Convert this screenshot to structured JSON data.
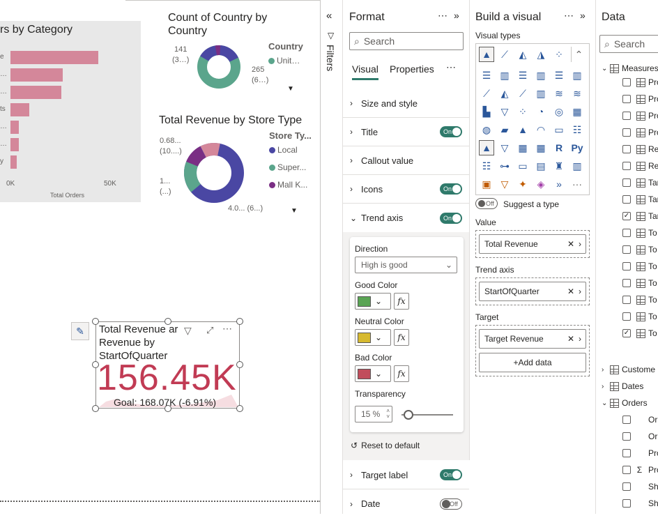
{
  "canvas": {
    "bar_chart": {
      "title": "rs by Category",
      "xlabel": "Total Orders",
      "ticks": [
        "0K",
        "50K"
      ],
      "row_labels": [
        "e",
        "…",
        "…",
        "ts",
        "…",
        "…",
        "y"
      ]
    },
    "donut1": {
      "title_line1": "Count of Country by",
      "title_line2": "Country",
      "legend_title": "Country",
      "legend": [
        {
          "label": "Unit…",
          "color": "#5ba58c"
        }
      ],
      "labels": [
        {
          "l1": "141",
          "l2": "(3…)"
        },
        {
          "l1": "265",
          "l2": "(6…)"
        }
      ]
    },
    "donut2": {
      "title": "Total Revenue by Store Type",
      "legend_title": "Store Ty...",
      "legend": [
        {
          "label": "Local",
          "color": "#4a47a3"
        },
        {
          "label": "Super...",
          "color": "#5ba58c"
        },
        {
          "label": "Mall K...",
          "color": "#7a2e84"
        }
      ],
      "labels": [
        {
          "l1": "0.68...",
          "l2": "(10....)"
        },
        {
          "l1": "1...",
          "l2": "(...)"
        },
        {
          "l1": "4.0... (6...)",
          "l2": ""
        }
      ]
    },
    "kpi": {
      "title_line1": "Total Revenue ar",
      "title_line2": "Revenue by",
      "title_line3": "StartOfQuarter",
      "value": "156.45K",
      "goal": "Goal: 168.07K (-6.91%)"
    }
  },
  "filters": {
    "label": "Filters"
  },
  "format": {
    "title": "Format",
    "search_placeholder": "Search",
    "tabs": [
      "Visual",
      "Properties"
    ],
    "sections": [
      {
        "label": "Size and style",
        "toggle": null
      },
      {
        "label": "Title",
        "toggle": "On"
      },
      {
        "label": "Callout value",
        "toggle": null
      },
      {
        "label": "Icons",
        "toggle": "On"
      },
      {
        "label": "Trend axis",
        "toggle": "On"
      }
    ],
    "trend": {
      "direction_label": "Direction",
      "direction_value": "High is good",
      "good_label": "Good Color",
      "good_color": "#5aa454",
      "neutral_label": "Neutral Color",
      "neutral_color": "#d6b92f",
      "bad_label": "Bad Color",
      "bad_color": "#c14d5c",
      "fx": "fx",
      "transparency_label": "Transparency",
      "transparency_value": "15 %",
      "reset": "Reset to default"
    },
    "bottom_sections": [
      {
        "label": "Target label",
        "toggle": "On"
      },
      {
        "label": "Date",
        "toggle": "Off"
      }
    ]
  },
  "build": {
    "title": "Build a visual",
    "visual_types_label": "Visual types",
    "suggest_toggle": "Off",
    "suggest_label": "Suggest a type",
    "value_label": "Value",
    "value_field": "Total Revenue",
    "trend_label": "Trend axis",
    "trend_field": "StartOfQuarter",
    "target_label": "Target",
    "target_field": "Target Revenue",
    "add_data": "+Add data",
    "r_icon": "R",
    "py_icon": "Py",
    "dots": "···"
  },
  "data": {
    "title": "Data",
    "search_placeholder": "Search",
    "measures_label": "Measures",
    "measure_items": [
      {
        "label": "Pro",
        "checked": false
      },
      {
        "label": "Pro",
        "checked": false
      },
      {
        "label": "Pro",
        "checked": false
      },
      {
        "label": "Pro",
        "checked": false
      },
      {
        "label": "Re",
        "checked": false
      },
      {
        "label": "Re",
        "checked": false
      },
      {
        "label": "Tar",
        "checked": false
      },
      {
        "label": "Tar",
        "checked": false
      },
      {
        "label": "Tar",
        "checked": true
      },
      {
        "label": "To",
        "checked": false
      },
      {
        "label": "To",
        "checked": false
      },
      {
        "label": "To",
        "checked": false
      },
      {
        "label": "To",
        "checked": false
      },
      {
        "label": "To",
        "checked": false
      },
      {
        "label": "To",
        "checked": false
      },
      {
        "label": "To",
        "checked": true
      }
    ],
    "tables": [
      "Custome",
      "Dates",
      "Orders"
    ],
    "order_items": [
      "Or",
      "Or",
      "Pro",
      "Pro",
      "Sh",
      "Sh"
    ]
  }
}
